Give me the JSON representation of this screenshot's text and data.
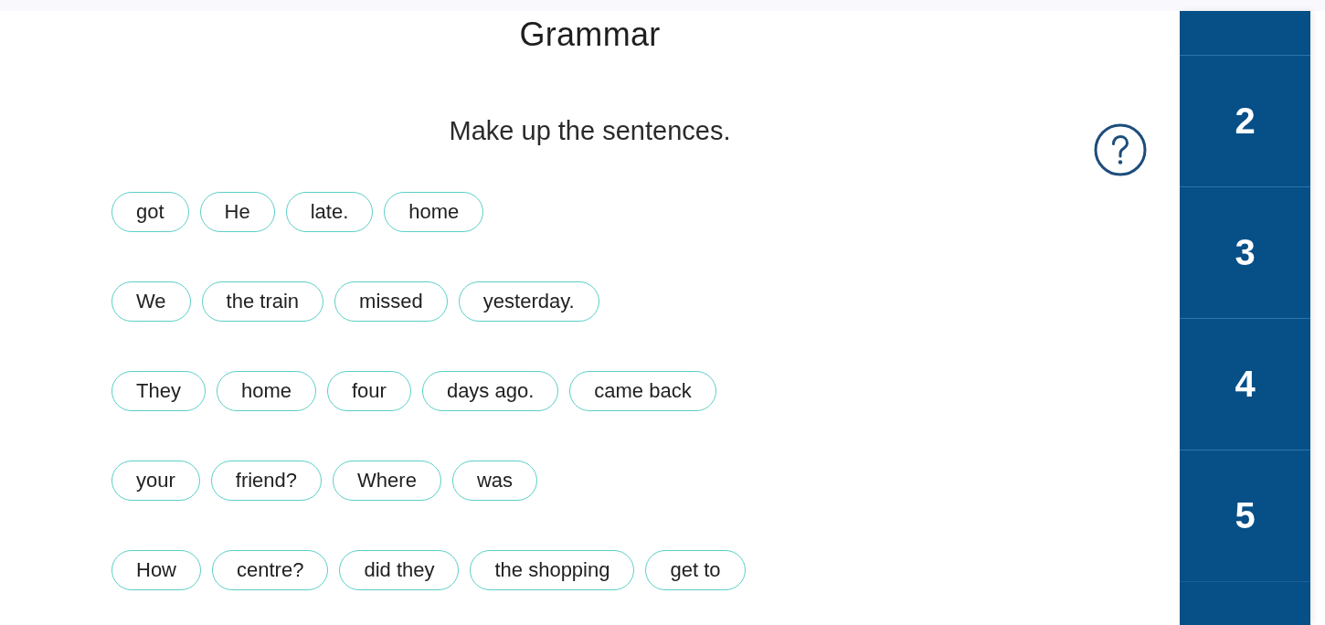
{
  "title": "Grammar",
  "instruction": "Make up the sentences.",
  "sentences": [
    {
      "words": [
        "got",
        "He",
        "late.",
        "home"
      ]
    },
    {
      "words": [
        "We",
        "the train",
        "missed",
        "yesterday."
      ]
    },
    {
      "words": [
        "They",
        "home",
        "four",
        "days ago.",
        "came back"
      ]
    },
    {
      "words": [
        "your",
        "friend?",
        "Where",
        "was"
      ]
    },
    {
      "words": [
        "How",
        "centre?",
        "did they",
        "the shopping",
        "get to"
      ]
    }
  ],
  "sidebar": {
    "items": [
      {
        "label": "2"
      },
      {
        "label": "3"
      },
      {
        "label": "4"
      },
      {
        "label": "5"
      }
    ]
  }
}
